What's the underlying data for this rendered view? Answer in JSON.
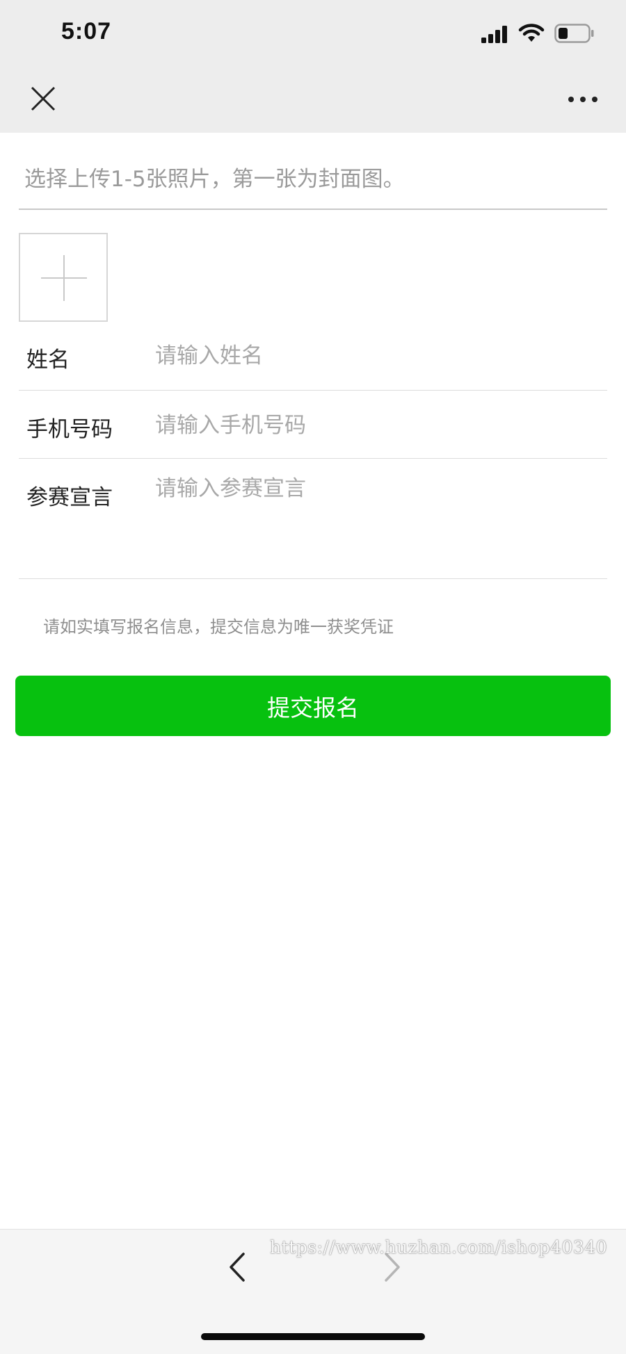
{
  "status_bar": {
    "time": "5:07",
    "icons": [
      "signal-icon",
      "wifi-icon",
      "battery-icon"
    ]
  },
  "nav": {
    "close_icon": "close-icon",
    "more_icon": "more-icon"
  },
  "form": {
    "photo_hint": "选择上传1-5张照片，第一张为封面图。",
    "upload_icon": "plus-icon",
    "name": {
      "label": "姓名",
      "placeholder": "请输入姓名"
    },
    "phone": {
      "label": "手机号码",
      "placeholder": "请输入手机号码"
    },
    "declaration": {
      "label": "参赛宣言",
      "placeholder": "请输入参赛宣言"
    },
    "notice": "请如实填写报名信息，提交信息为唯一获奖凭证",
    "submit_label": "提交报名"
  },
  "bottom_bar": {
    "back_icon": "chevron-left-icon",
    "forward_icon": "chevron-right-icon",
    "watermark": "https://www.huzhan.com/ishop40340"
  },
  "colors": {
    "accent": "#07c10f",
    "chrome": "#ededed",
    "placeholder": "#a8a8a8"
  }
}
